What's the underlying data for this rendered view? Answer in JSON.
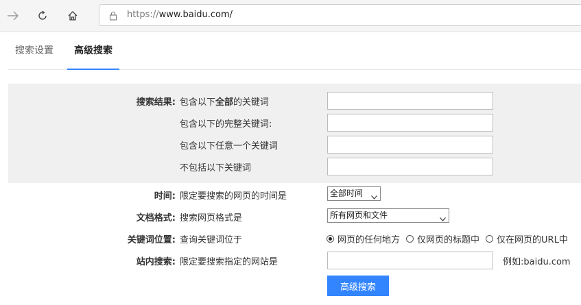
{
  "browser": {
    "url_protocol": "https://",
    "url_host": "www.baidu.com/"
  },
  "tabs": [
    {
      "label": "搜索设置"
    },
    {
      "label": "高级搜索"
    }
  ],
  "form": {
    "results_label": "搜索结果:",
    "all_prefix": "包含以下",
    "all_strong": "全部",
    "all_suffix": "的关键词",
    "exact": "包含以下的完整关键词:",
    "any": "包含以下任意一个关键词",
    "exclude": "不包括以下关键词",
    "time_label": "时间:",
    "time_desc": "限定要搜索的网页的时间是",
    "time_value": "全部时间",
    "format_label": "文档格式:",
    "format_desc": "搜索网页格式是",
    "format_value": "所有网页和文件",
    "position_label": "关键词位置:",
    "position_desc": "查询关键词位于",
    "position_options": [
      "网页的任何地方",
      "仅网页的标题中",
      "仅在网页的URL中"
    ],
    "site_label": "站内搜索:",
    "site_desc": "限定要搜索指定的网站是",
    "site_example": "例如:baidu.com",
    "submit_label": "高级搜索"
  }
}
